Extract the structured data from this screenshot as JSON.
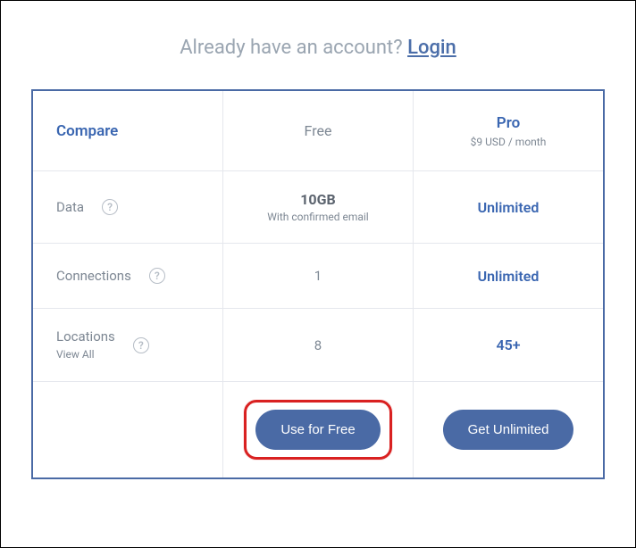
{
  "prompt": {
    "text": "Already have an account? ",
    "login": "Login"
  },
  "headers": {
    "compare": "Compare",
    "free": "Free",
    "pro": "Pro",
    "pro_sub": "$9 USD / month"
  },
  "rows": {
    "data": {
      "label": "Data",
      "free_value": "10GB",
      "free_sub": "With confirmed email",
      "pro_value": "Unlimited"
    },
    "connections": {
      "label": "Connections",
      "free_value": "1",
      "pro_value": "Unlimited"
    },
    "locations": {
      "label": "Locations",
      "label_sub": "View All",
      "free_value": "8",
      "pro_value": "45+"
    }
  },
  "cta": {
    "free": "Use for Free",
    "pro": "Get Unlimited"
  },
  "help_glyph": "?"
}
